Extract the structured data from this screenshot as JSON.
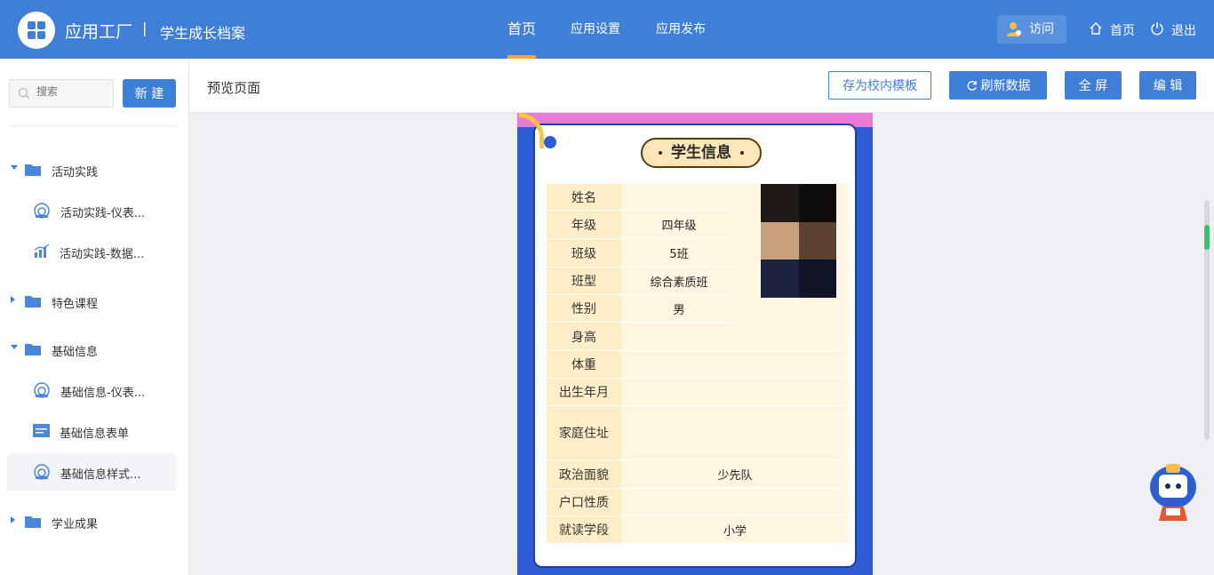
{
  "header": {
    "app_name": "应用工厂",
    "separator": "|",
    "sub_name": "学生成长档案",
    "nav": [
      {
        "label": "首页",
        "active": true
      },
      {
        "label": "应用设置",
        "active": false
      },
      {
        "label": "应用发布",
        "active": false
      }
    ],
    "visit_label": "访问",
    "home_label": "首页",
    "logout_label": "退出",
    "brand_color": "#3f7fd8",
    "accent_color": "#f5a623"
  },
  "sidebar": {
    "search_placeholder": "搜索",
    "new_label": "新 建",
    "tree": [
      {
        "label": "活动实践",
        "type": "folder",
        "expanded": true
      },
      {
        "label": "活动实践-仪表...",
        "type": "dashboard",
        "icon": "dashboard-icon"
      },
      {
        "label": "活动实践-数据...",
        "type": "chart",
        "icon": "bar-chart-icon"
      },
      {
        "label": "特色课程",
        "type": "folder",
        "expanded": false
      },
      {
        "label": "基础信息",
        "type": "folder",
        "expanded": true
      },
      {
        "label": "基础信息-仪表...",
        "type": "dashboard",
        "icon": "dashboard-icon"
      },
      {
        "label": "基础信息表单",
        "type": "form",
        "icon": "form-icon"
      },
      {
        "label": "基础信息样式...",
        "type": "dashboard",
        "icon": "dashboard-icon",
        "selected": true
      },
      {
        "label": "学业成果",
        "type": "folder",
        "expanded": false
      }
    ]
  },
  "toolbar": {
    "page_title": "预览页面",
    "save_template_label": "存为校内模板",
    "refresh_label": "刷新数据",
    "fullscreen_label": "全 屏",
    "edit_label": "编 辑"
  },
  "card": {
    "title": "学生信息",
    "rows": [
      {
        "key": "姓名",
        "value": ""
      },
      {
        "key": "年级",
        "value": "四年级"
      },
      {
        "key": "班级",
        "value": "5班"
      },
      {
        "key": "班型",
        "value": "综合素质班"
      },
      {
        "key": "性别",
        "value": "男"
      },
      {
        "key": "身高",
        "value": ""
      },
      {
        "key": "体重",
        "value": ""
      },
      {
        "key": "出生年月",
        "value": ""
      },
      {
        "key": "家庭住址",
        "value": ""
      },
      {
        "key": "政治面貌",
        "value": "少先队"
      },
      {
        "key": "户口性质",
        "value": ""
      },
      {
        "key": "就读学段",
        "value": "小学"
      }
    ],
    "photo_colors": [
      "#1e1a17",
      "#0e0d0c",
      "#c7a07c",
      "#5a4330",
      "#1a2240",
      "#111426"
    ]
  }
}
